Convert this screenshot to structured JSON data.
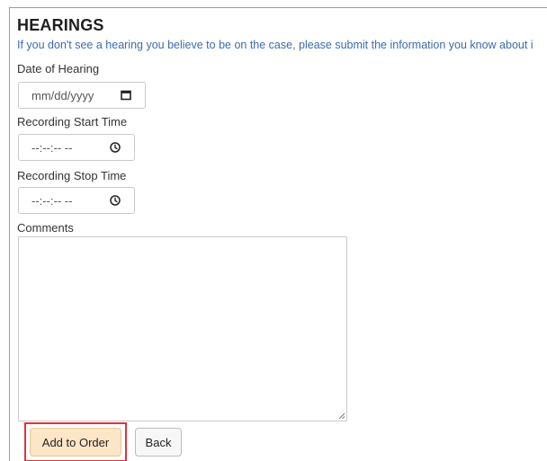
{
  "section": {
    "title": "HEARINGS",
    "intro": "If you don't see a hearing you believe to be on the case, please submit the information you know about i"
  },
  "fields": {
    "date_of_hearing": {
      "label": "Date of Hearing",
      "placeholder": "mm/dd/yyyy",
      "icon": "calendar-icon"
    },
    "recording_start": {
      "label": "Recording Start Time",
      "placeholder": "--:--:-- --",
      "icon": "clock-icon"
    },
    "recording_stop": {
      "label": "Recording Stop Time",
      "placeholder": "--:--:-- --",
      "icon": "clock-icon"
    },
    "comments": {
      "label": "Comments",
      "value": ""
    }
  },
  "actions": {
    "add_to_order": "Add to Order",
    "back": "Back"
  },
  "colors": {
    "primary_button_bg": "#fde5c7",
    "highlight_border": "#e0333a",
    "intro_text": "#3a6cae"
  }
}
